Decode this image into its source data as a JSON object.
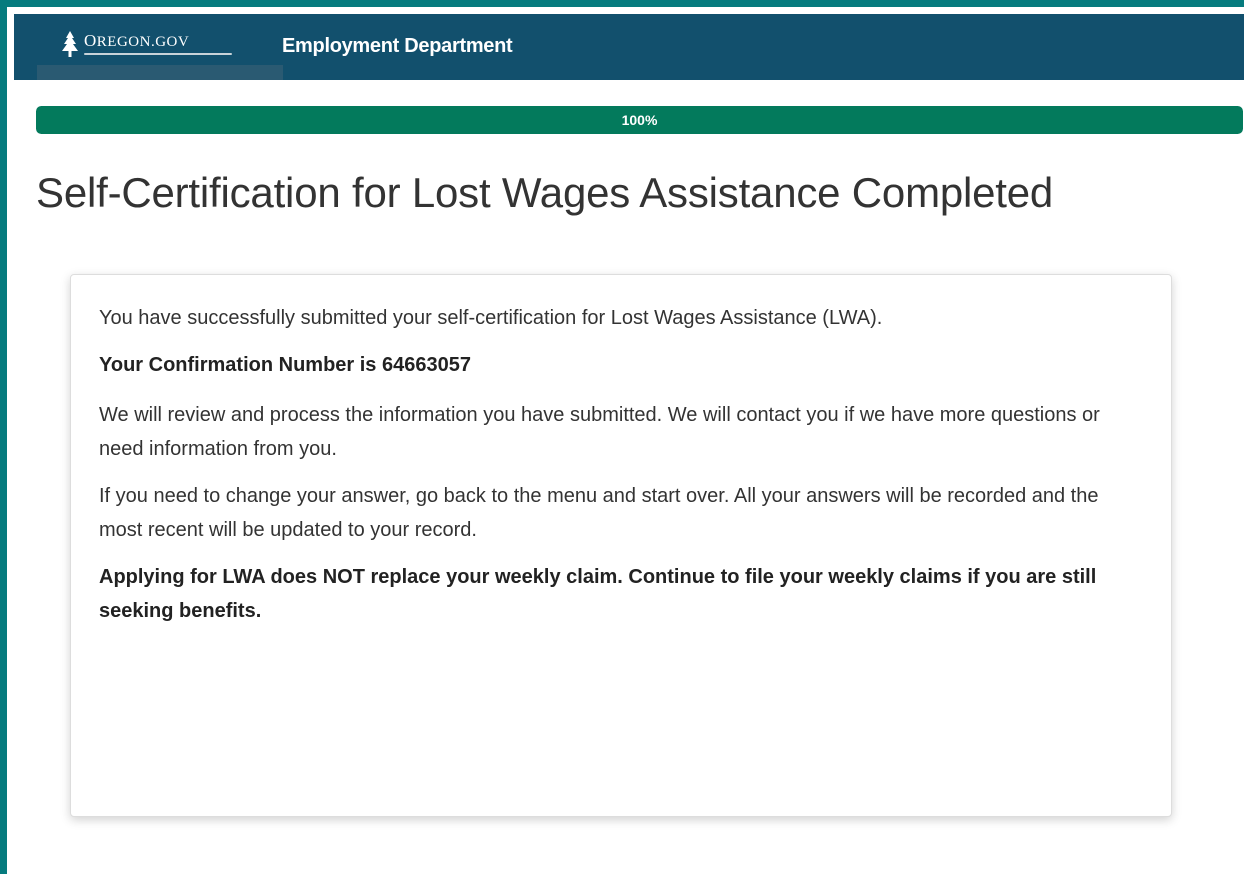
{
  "header": {
    "logo_text": "OREGON.GOV",
    "logo_alt": "Oregon.gov",
    "department": "Employment Department"
  },
  "progress": {
    "percent": 100,
    "label": "100%"
  },
  "page_title": "Self-Certification for Lost Wages Assistance Completed",
  "card": {
    "p1": "You have successfully submitted your self-certification for Lost Wages Assistance (LWA).",
    "confirmation": "Your Confirmation Number is 64663057",
    "p2": "We will review and process the information you have submitted. We will contact you if we have more questions or need information from you.",
    "p3": "If you need to change your answer, go back to the menu and start over. All your answers will be recorded and the most recent will be updated to your record.",
    "notice": "Applying for LWA does NOT replace your weekly claim. Continue to file your weekly claims if you are still seeking benefits."
  },
  "colors": {
    "frame": "#067b7e",
    "header": "#12506d",
    "progress": "#037a5c"
  },
  "icons": [
    "tree-logo-icon"
  ]
}
